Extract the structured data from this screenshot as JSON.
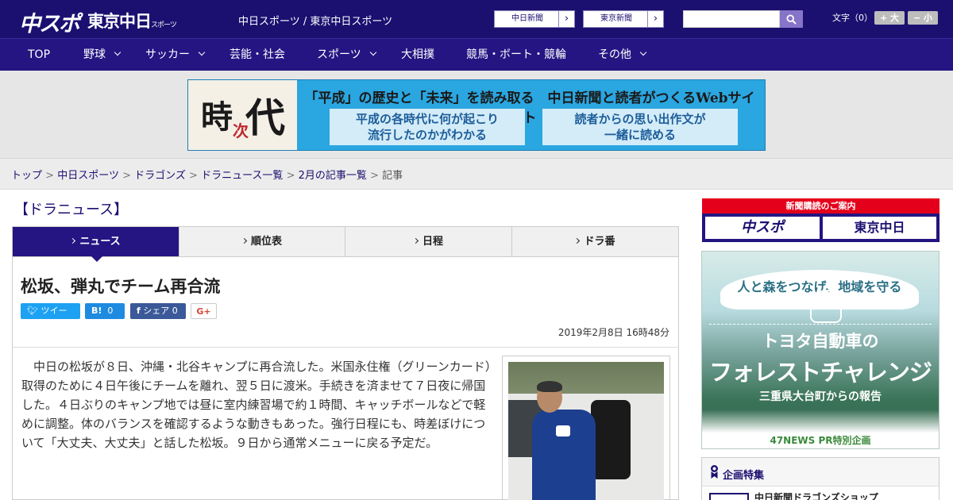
{
  "header": {
    "logo_chuspo": "中スポ",
    "logo_tokyo": "東京中日",
    "logo_tokyo_small": "スポーツ",
    "site_name": "中日スポーツ / 東京中日スポーツ",
    "paper_links": [
      "中日新聞",
      "東京新聞"
    ],
    "search_placeholder": "",
    "font_label": "文字（0）",
    "font_bigger": "+ 大",
    "font_smaller": "− 小"
  },
  "nav": {
    "items": [
      {
        "label": "TOP",
        "has_menu": false
      },
      {
        "label": "野球",
        "has_menu": true
      },
      {
        "label": "サッカー",
        "has_menu": true
      },
      {
        "label": "芸能・社会",
        "has_menu": false
      },
      {
        "label": "スポーツ",
        "has_menu": true
      },
      {
        "label": "大相撲",
        "has_menu": false
      },
      {
        "label": "競馬・ボート・競輪",
        "has_menu": false
      },
      {
        "label": "その他",
        "has_menu": true
      }
    ]
  },
  "banner": {
    "logo_ji": "時",
    "logo_dai": "代",
    "logo_tsugi": "次",
    "headline": "「平成」の歴史と「未来」を読み取る　中日新聞と読者がつくるWebサイト",
    "box1_line1": "平成の各時代に何が起こり",
    "box1_line2": "流行したのかがわかる",
    "box2_line1": "読者からの思い出作文が",
    "box2_line2": "一緒に読める"
  },
  "breadcrumb": {
    "items": [
      "トップ",
      "中日スポーツ",
      "ドラゴンズ",
      "ドラニュース一覧",
      "2月の記事一覧"
    ],
    "current": "記事",
    "sep": ">"
  },
  "section": {
    "title": "【ドラニュース】"
  },
  "tabs": [
    {
      "label": "ニュース",
      "active": true
    },
    {
      "label": "順位表",
      "active": false
    },
    {
      "label": "日程",
      "active": false
    },
    {
      "label": "ドラ番",
      "active": false
    }
  ],
  "article": {
    "headline": "松坂、弾丸でチーム再合流",
    "share": {
      "tweet": "ツイート",
      "hatena_icon": "B!",
      "hatena_count": "0",
      "facebook": "シェア 0",
      "gplus": "G+"
    },
    "date": "2019年2月8日 16時48分",
    "body": "　中日の松坂が８日、沖縄・北谷キャンプに再合流した。米国永住権（グリーンカード）取得のために４日午後にチームを離れ、翌５日に渡米。手続きを済ませて７日夜に帰国した。４日ぶりのキャンプ地では昼に室内練習場で約１時間、キャッチボールなどで軽めに調整。体のバランスを確認するような動きもあった。強行日程にも、時差ぼけについて「大丈夫、大丈夫」と話した松坂。９日から通常メニューに戻る予定だ。"
  },
  "sidebar": {
    "subscribe_head": "新聞購読のご案内",
    "subscribe_a": "中スポ",
    "subscribe_b": "東京中日",
    "ad_ribbon": "人と森をつなげ、地域を守る",
    "ad_line1": "トヨタ自動車の",
    "ad_line2": "フォレストチャレンジ",
    "ad_line3": "三重県大台町からの報告",
    "ad_credit": "47NEWS PR特別企画",
    "feature_title": "企画特集",
    "feature_item": "中日新聞ドラゴンズショップ"
  },
  "colors": {
    "brand_navy": "#1b1070",
    "nav_bg": "#241583",
    "accent_red": "#e4001b",
    "twitter": "#1da1f2",
    "facebook": "#3b5998"
  }
}
